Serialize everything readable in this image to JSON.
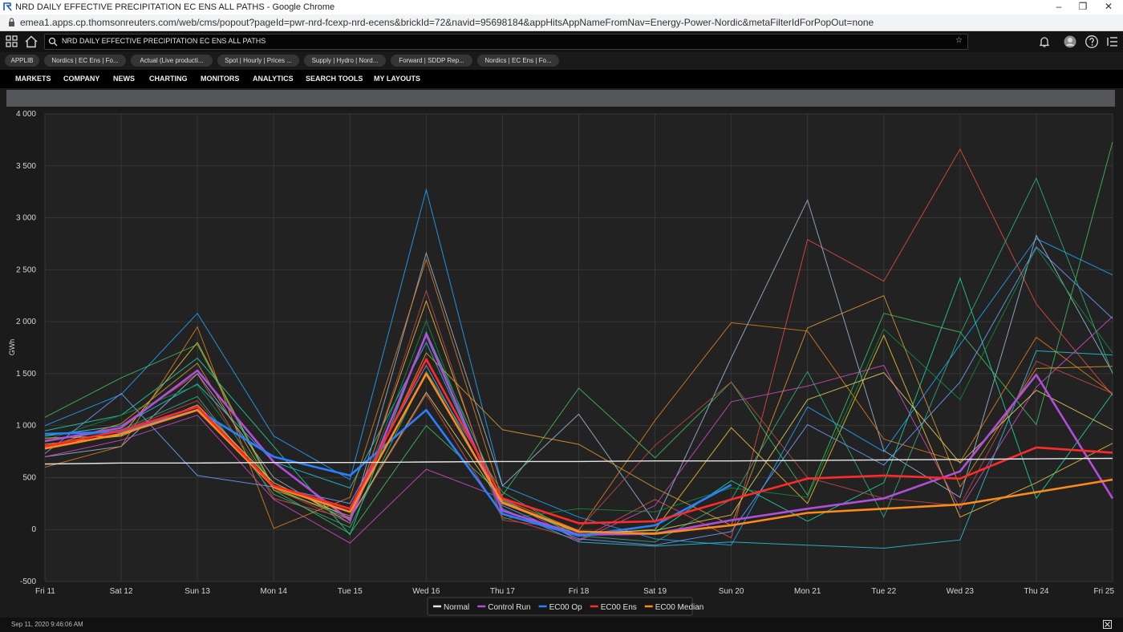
{
  "window": {
    "title": "NRD DAILY EFFECTIVE PRECIPITATION EC ENS ALL PATHS - Google Chrome",
    "url": "emea1.apps.cp.thomsonreuters.com/web/cms/popout?pageId=pwr-nrd-fcexp-nrd-ecens&brickId=72&navid=95698184&appHitsAppNameFromNav=Energy-Power-Nordic&metaFilterIdForPopOut=none",
    "minimize": "–",
    "restore": "❐",
    "close": "✕"
  },
  "toolbar": {
    "search_text": "NRD DAILY EFFECTIVE PRECIPITATION EC ENS ALL PATHS",
    "star": "☆"
  },
  "tabs": [
    {
      "label": "APPLIB"
    },
    {
      "label": "Nordics | EC Ens | Fo..."
    },
    {
      "label": "Actual (Live producti..."
    },
    {
      "label": "Spot | Hourly | Prices ..."
    },
    {
      "label": "Supply | Hydro | Nord..."
    },
    {
      "label": "Forward | SDDP Rep..."
    },
    {
      "label": "Nordics | EC Ens | Fo..."
    }
  ],
  "menu": [
    {
      "label": "MARKETS"
    },
    {
      "label": "COMPANY"
    },
    {
      "label": "NEWS"
    },
    {
      "label": "CHARTING"
    },
    {
      "label": "MONITORS"
    },
    {
      "label": "ANALYTICS"
    },
    {
      "label": "SEARCH TOOLS"
    },
    {
      "label": "MY LAYOUTS"
    }
  ],
  "footer": {
    "timestamp": "Sep 11, 2020 9:46:06 AM"
  },
  "colors": {
    "accent": "#1a78ff",
    "background": "#1b1b1b"
  },
  "chart_data": {
    "type": "line",
    "ylabel": "GWh",
    "ylim": [
      -500,
      4000
    ],
    "yticks": [
      -500,
      0,
      500,
      1000,
      1500,
      2000,
      2500,
      3000,
      3500,
      4000
    ],
    "ytick_labels": [
      "-500",
      "0",
      "500",
      "1 000",
      "1 500",
      "2 000",
      "2 500",
      "3 000",
      "3 500",
      "4 000"
    ],
    "categories": [
      "Fri 11",
      "Sat 12",
      "Sun 13",
      "Mon 14",
      "Tue 15",
      "Wed 16",
      "Thu 17",
      "Fri 18",
      "Sat 19",
      "Sun 20",
      "Mon 21",
      "Tue 22",
      "Wed 23",
      "Thu 24",
      "Fri 25"
    ],
    "grid": true,
    "legend_position": "bottom-center",
    "series": [
      {
        "name": "Normal",
        "color": "#e6e6e6",
        "width": 1.4,
        "values": [
          630,
          640,
          640,
          645,
          645,
          650,
          655,
          655,
          660,
          660,
          665,
          670,
          675,
          680,
          685
        ]
      },
      {
        "name": "Control Run",
        "color": "#b14fd9",
        "width": 2.6,
        "values": [
          850,
          980,
          1530,
          650,
          90,
          1880,
          180,
          -50,
          -40,
          90,
          200,
          300,
          560,
          1490,
          300
        ]
      },
      {
        "name": "EC00 Op",
        "color": "#2a7fff",
        "width": 2.6,
        "values": [
          920,
          940,
          1150,
          700,
          520,
          1150,
          150,
          -60,
          40,
          430,
          null,
          null,
          null,
          null,
          null
        ]
      },
      {
        "name": "EC00 Ens",
        "color": "#ff2a2a",
        "width": 2.6,
        "values": [
          800,
          950,
          1180,
          420,
          200,
          1640,
          300,
          60,
          80,
          290,
          490,
          520,
          490,
          790,
          740
        ]
      },
      {
        "name": "EC00 Median",
        "color": "#ff8a1c",
        "width": 2.6,
        "values": [
          780,
          920,
          1150,
          410,
          170,
          1500,
          260,
          -20,
          -40,
          40,
          160,
          200,
          240,
          360,
          480
        ]
      }
    ],
    "ensemble_members": [
      {
        "color": "#1fa8ff",
        "values": [
          1000,
          1300,
          2080,
          900,
          480,
          3270,
          420,
          120,
          -90,
          -150,
          1180,
          750,
          1780,
          2800,
          2450
        ]
      },
      {
        "color": "#3fbf5f",
        "values": [
          1080,
          1460,
          1780,
          380,
          -40,
          1000,
          330,
          1360,
          690,
          1420,
          330,
          2080,
          1900,
          1010,
          3730
        ]
      },
      {
        "color": "#e84b45",
        "values": [
          900,
          1000,
          1500,
          300,
          100,
          1300,
          120,
          -100,
          290,
          -80,
          2790,
          2390,
          3660,
          2170,
          1290
        ]
      },
      {
        "color": "#9ab8d6",
        "values": [
          700,
          800,
          1500,
          500,
          60,
          2660,
          420,
          1110,
          70,
          1650,
          3170,
          760,
          310,
          2830,
          1510
        ]
      },
      {
        "color": "#f1c232",
        "values": [
          820,
          900,
          1800,
          400,
          100,
          2200,
          150,
          -50,
          0,
          980,
          250,
          1870,
          120,
          450,
          830
        ]
      },
      {
        "color": "#e0801f",
        "values": [
          600,
          800,
          1950,
          10,
          310,
          2600,
          290,
          -10,
          1050,
          1990,
          1910,
          870,
          650,
          1850,
          1310
        ]
      },
      {
        "color": "#1fd6a0",
        "values": [
          950,
          1100,
          1650,
          800,
          -50,
          1900,
          280,
          -60,
          -30,
          470,
          80,
          450,
          2420,
          300,
          1310
        ]
      },
      {
        "color": "#22c7d6",
        "values": [
          900,
          1000,
          1400,
          650,
          400,
          1800,
          200,
          -120,
          -160,
          -120,
          -150,
          -180,
          -100,
          1720,
          1680
        ]
      },
      {
        "color": "#d24bc2",
        "values": [
          700,
          860,
          1100,
          290,
          -130,
          580,
          300,
          -110,
          230,
          1230,
          1380,
          1580,
          200,
          1370,
          2050
        ]
      },
      {
        "color": "#0f8f3a",
        "values": [
          860,
          1100,
          1390,
          410,
          100,
          2010,
          100,
          200,
          170,
          400,
          310,
          1930,
          1250,
          2710,
          1700
        ]
      },
      {
        "color": "#c04848",
        "values": [
          800,
          950,
          1240,
          400,
          60,
          2300,
          90,
          0,
          810,
          1420,
          500,
          300,
          230,
          1620,
          1310
        ]
      },
      {
        "color": "#d99930",
        "values": [
          790,
          1020,
          1600,
          380,
          130,
          1700,
          960,
          820,
          400,
          40,
          1940,
          2250,
          410,
          1550,
          1570
        ]
      },
      {
        "color": "#2db07a",
        "values": [
          850,
          960,
          1280,
          340,
          20,
          1520,
          360,
          -60,
          -120,
          290,
          1520,
          120,
          1880,
          3380,
          1500
        ]
      },
      {
        "color": "#6fa0ff",
        "values": [
          730,
          1310,
          520,
          410,
          250,
          1580,
          230,
          -90,
          -150,
          -20,
          1010,
          620,
          1420,
          2720,
          2030
        ]
      },
      {
        "color": "#e0d060",
        "values": [
          880,
          900,
          1200,
          450,
          110,
          1320,
          250,
          -30,
          -10,
          140,
          1250,
          1510,
          640,
          1340,
          960
        ]
      }
    ]
  }
}
